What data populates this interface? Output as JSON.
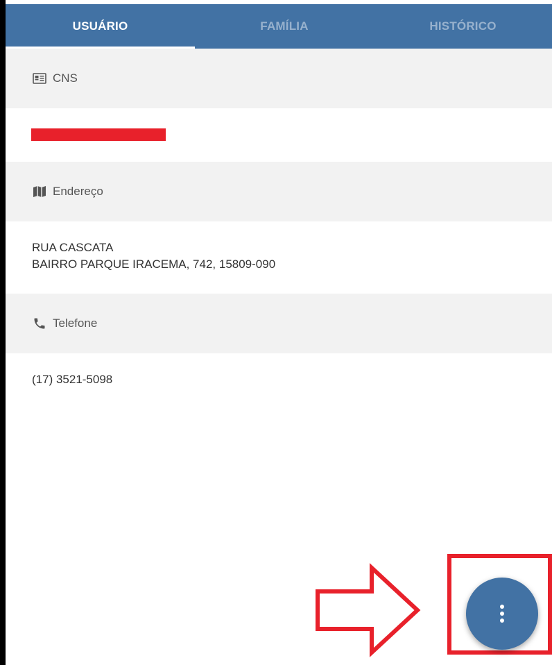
{
  "colors": {
    "primary": "#4272a4",
    "annotation": "#e8212b",
    "section_bg": "#f2f2f2"
  },
  "tabs": [
    {
      "label": "USUÁRIO",
      "active": true
    },
    {
      "label": "FAMÍLIA",
      "active": false
    },
    {
      "label": "HISTÓRICO",
      "active": false
    }
  ],
  "sections": {
    "cns": {
      "icon": "id-card-icon",
      "label": "CNS",
      "value_redacted": true
    },
    "endereco": {
      "icon": "map-icon",
      "label": "Endereço",
      "line1": "RUA CASCATA",
      "line2": "BAIRRO PARQUE IRACEMA, 742, 15809-090"
    },
    "telefone": {
      "icon": "phone-icon",
      "label": "Telefone",
      "value": "(17) 3521-5098"
    }
  },
  "fab": {
    "icon": "more-vertical-icon"
  },
  "annotation": {
    "arrow_icon": "right-arrow-outline-icon"
  }
}
